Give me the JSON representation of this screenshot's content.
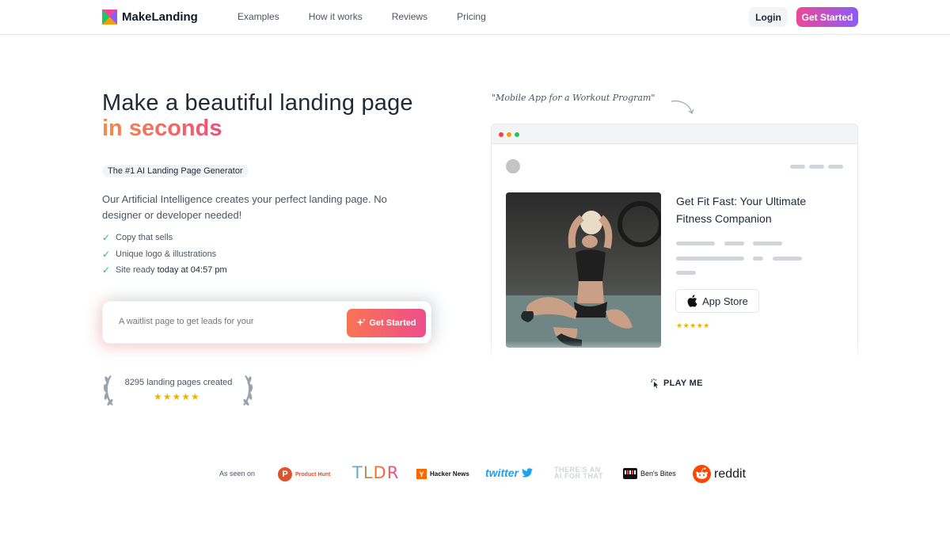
{
  "nav": {
    "brand": "MakeLanding",
    "links": [
      "Examples",
      "How it works",
      "Reviews",
      "Pricing"
    ],
    "login": "Login",
    "get_started": "Get Started"
  },
  "hero": {
    "title_line1": "Make a beautiful landing page",
    "title_line2": "in seconds",
    "badge": "The #1 AI Landing Page Generator",
    "description": "Our Artificial Intelligence creates your perfect landing page. No designer or developer needed!",
    "features": [
      {
        "text": "Copy that sells",
        "strong": ""
      },
      {
        "text": "Unique logo & illustrations",
        "strong": ""
      },
      {
        "text": "Site ready ",
        "strong": "today at 04:57 pm"
      }
    ],
    "input_placeholder": "A waitlist page to get leads for your",
    "input_button": "Get Started",
    "social_proof": "8295 landing pages created",
    "rating_stars": "★★★★★"
  },
  "preview": {
    "prompt_caption": "\"Mobile App for a Workout Program\"",
    "mock_title": "Get Fit Fast: Your Ultimate Fitness Companion",
    "app_store_label": "App Store",
    "mock_stars": "★★★★★",
    "play_label": "PLAY ME"
  },
  "press": {
    "label": "As seen on",
    "product_hunt": "Product Hunt",
    "product_hunt_letter": "P",
    "tldr": "TLDR",
    "hacker_news_letter": "Y",
    "hacker_news": "Hacker News",
    "twitter": "twitter",
    "aift": "THERE'S AN AI FOR THAT",
    "bens_bites": "Ben's Bites",
    "reddit": "reddit"
  },
  "colors": {
    "accent_gradient_start": "#ec4899",
    "accent_gradient_end": "#8b5cf6",
    "title_gradient_start": "#f58a4a",
    "title_gradient_end": "#ec4f7a",
    "check": "#22c55e",
    "star": "#eab308"
  }
}
